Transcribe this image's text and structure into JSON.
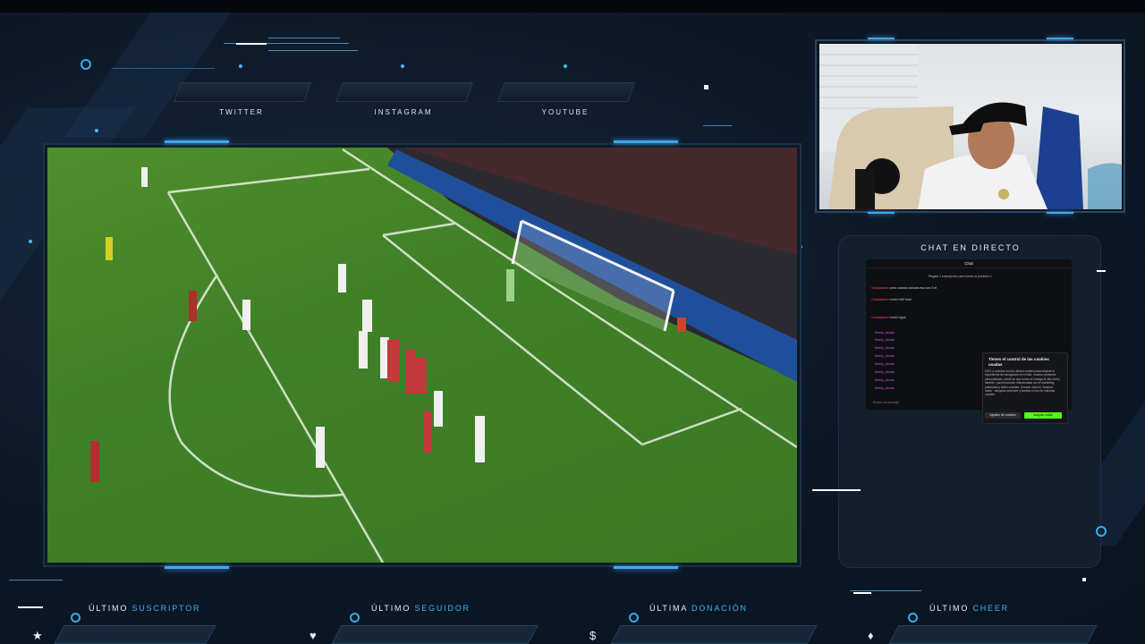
{
  "social": {
    "twitter": "TWITTER",
    "instagram": "INSTAGRAM",
    "youtube": "YOUTUBE"
  },
  "chat": {
    "title": "CHAT EN DIRECTO",
    "tab": "Chat",
    "pinned": "Regala 1 suscripción para tomar la posición 1",
    "intro_user": "Gnahladamo",
    "intro_text": "pero cuando colocas eso son 3 el",
    "messages": [
      {
        "user": "Gnahladamo",
        "text": "envió Hell Yeah"
      },
      {
        "user": "Gnahladamo",
        "text": "envió Hype"
      }
    ],
    "list_users": [
      "Kenny_Acosa",
      "Kenny_Acosa",
      "Kenny_Acosa",
      "Kenny_Acosa",
      "Kenny_Acosa",
      "Kenny_Acosa",
      "Kenny_Acosa",
      "Kenny_Acosa"
    ],
    "input_placeholder": "Enviar un mensaje",
    "cookie": {
      "title": "Tienes el control de las cookies usadas",
      "body": "KICK y nuestros socios utilizan cookies para mejorar tu experiencia de navegación en el sitio, mostrar contenido personalizado, medir de qué forma se navega el sitio web y también, para funciones relacionadas con el marketing, publicidad y redes sociales. Al hacer click en \"Aceptar todas\", aseguras entender y aceptar el uso de nuestras cookies.",
      "settings_button": "Ajustes de cookies",
      "accept_button": "Aceptar todas"
    }
  },
  "bottom": {
    "suscriptor_prefix": "ÚLTIMO",
    "suscriptor_accent": "SUSCRIPTOR",
    "seguidor_prefix": "ÚLTIMO",
    "seguidor_accent": "SEGUIDOR",
    "donacion_prefix": "ÚLTIMA",
    "donacion_accent": "DONACIÓN",
    "cheer_prefix": "ÚLTIMO",
    "cheer_accent": "CHEER"
  },
  "icons": {
    "suscriptor": "★",
    "seguidor": "♥",
    "donacion": "$",
    "cheer": "♦"
  },
  "colors": {
    "accent": "#3fb0f0",
    "background": "#0b1622",
    "accept_button": "#53fc18"
  }
}
